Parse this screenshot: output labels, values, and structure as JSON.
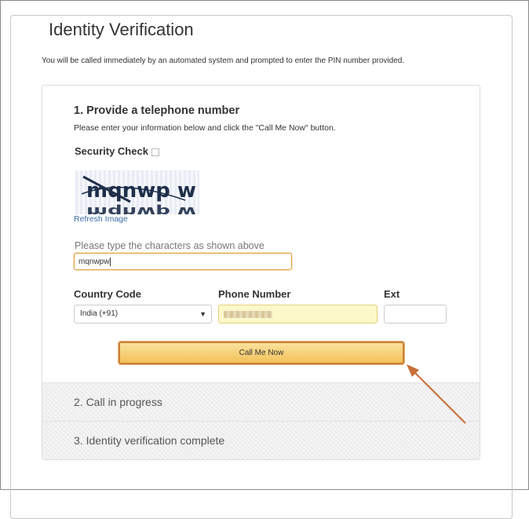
{
  "page": {
    "legend": "Identity Verification",
    "intro": "You will be called immediately by an automated system and prompted to enter the PIN number provided."
  },
  "step1": {
    "title": "1. Provide a telephone number",
    "description": "Please enter your information below and click the \"Call Me Now\" button.",
    "security_check_label": "Security Check",
    "captcha_text": "mqnwp w",
    "refresh_label": "Refresh Image",
    "captcha_prompt": "Please type the characters as shown above",
    "captcha_value": "mqnwpw",
    "country_label": "Country Code",
    "country_value": "India (+91)",
    "phone_label": "Phone Number",
    "ext_label": "Ext",
    "call_button": "Call Me Now"
  },
  "steps": [
    {
      "label": "2. Call in progress"
    },
    {
      "label": "3. Identity verification complete"
    }
  ],
  "colors": {
    "button_fill": "#f3c15a",
    "button_border": "#c9803b",
    "annotation_arrow": "#c8703a",
    "phone_field_bg": "#fcf8c9"
  },
  "icons": {
    "info": "info-icon",
    "dropdown": "chevron-down-icon"
  }
}
